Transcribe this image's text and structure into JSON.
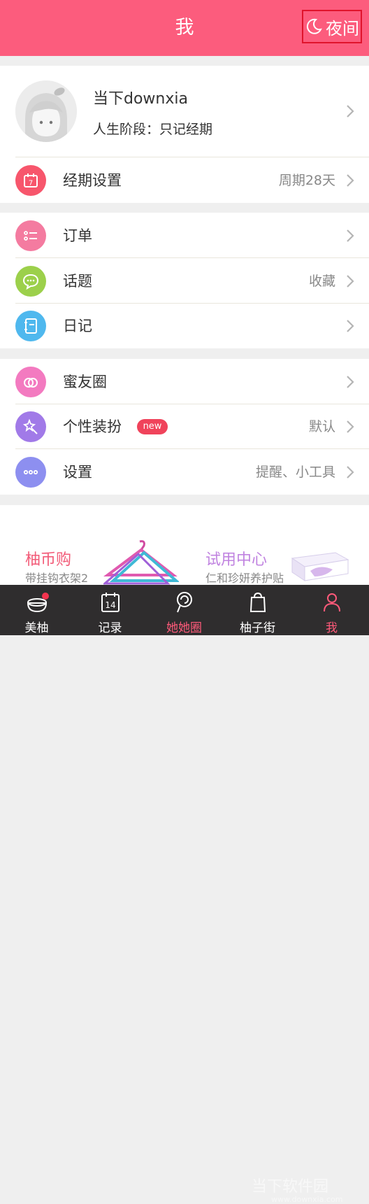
{
  "header": {
    "title": "我",
    "night_mode_label": "夜间",
    "bg_color": "#fc5c7d"
  },
  "profile": {
    "name": "当下downxia",
    "stage": "人生阶段：只记经期"
  },
  "menu": {
    "period_settings": {
      "label": "经期设置",
      "value": "周期28天",
      "icon": "calendar-7-icon",
      "color": "#f7566c"
    },
    "orders": {
      "label": "订单",
      "value": "",
      "icon": "list-icon",
      "color": "#f47ba0"
    },
    "topics": {
      "label": "话题",
      "value": "收藏",
      "icon": "chat-bubble-icon",
      "color": "#9cd04b"
    },
    "diary": {
      "label": "日记",
      "value": "",
      "icon": "notebook-icon",
      "color": "#4fb8ee"
    },
    "friends_circle": {
      "label": "蜜友圈",
      "value": "",
      "icon": "heart-rings-icon",
      "color": "#f37ac0"
    },
    "personalize": {
      "label": "个性装扮",
      "badge": "new",
      "value": "默认",
      "icon": "magic-wand-icon",
      "color": "#a17ae8"
    },
    "settings": {
      "label": "设置",
      "value": "提醒、小工具",
      "icon": "more-dots-icon",
      "color": "#8d8ff0"
    }
  },
  "promos": [
    {
      "title": "柚币购",
      "subtitle": "带挂钩衣架2",
      "color": "#f25b78"
    },
    {
      "title": "试用中心",
      "subtitle": "仁和珍妍养护贴",
      "color": "#c083e0"
    }
  ],
  "tabbar": {
    "tabs": [
      {
        "label": "美柚",
        "icon": "pomelo-icon"
      },
      {
        "label": "记录",
        "icon": "calendar-14-icon",
        "day": "14"
      },
      {
        "label": "她她圈",
        "icon": "lollipop-icon"
      },
      {
        "label": "柚子街",
        "icon": "shopping-bag-icon"
      },
      {
        "label": "我",
        "icon": "person-icon"
      }
    ]
  },
  "watermark": {
    "text": "当下软件园",
    "url": "www.downxia.com"
  }
}
